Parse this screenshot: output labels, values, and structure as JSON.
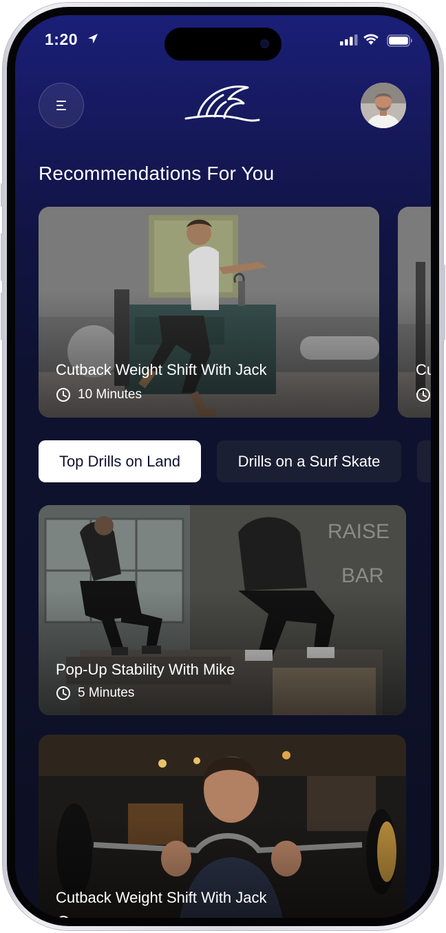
{
  "status_bar": {
    "time": "1:20",
    "icons": [
      "location-arrow-icon",
      "cellular-signal-icon",
      "wifi-icon",
      "battery-icon"
    ]
  },
  "header": {
    "menu_icon": "menu-icon",
    "logo_icon": "wave-fin-logo",
    "avatar": "user-avatar"
  },
  "recommendations": {
    "title": "Recommendations For You",
    "items": [
      {
        "title": "Cutback Weight Shift With Jack",
        "duration": "10 Minutes",
        "icon": "clock-icon"
      },
      {
        "title": "Cu",
        "duration": "",
        "icon": "clock-icon"
      }
    ]
  },
  "tabs": [
    {
      "label": "Top Drills on Land",
      "active": true
    },
    {
      "label": "Drills on a Surf Skate",
      "active": false
    },
    {
      "label": "",
      "active": false
    }
  ],
  "drills": [
    {
      "title": "Pop-Up Stability With Mike",
      "duration": "5 Minutes",
      "icon": "clock-icon"
    },
    {
      "title": "Cutback Weight Shift With Jack",
      "duration": "",
      "icon": "clock-icon"
    }
  ],
  "colors": {
    "bg_top": "#1a1f78",
    "bg_bottom": "#0d1022",
    "tab_active_bg": "#ffffff",
    "tab_inactive_bg": "#1b1f33",
    "text": "#ffffff"
  }
}
